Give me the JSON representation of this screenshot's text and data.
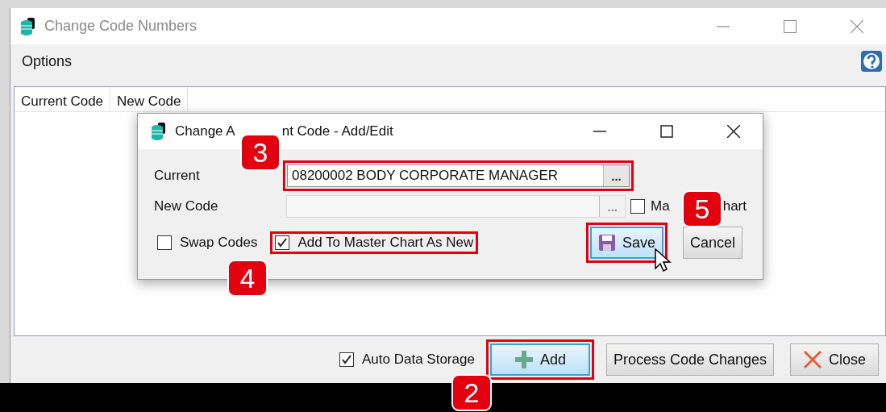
{
  "window": {
    "title": "Change Code Numbers"
  },
  "menu": [
    {
      "label": "Options"
    }
  ],
  "table": {
    "columns": [
      "Current Code",
      "New Code"
    ]
  },
  "footer": {
    "auto_data_storage": {
      "label": "Auto Data Storage",
      "checked": true
    },
    "buttons": [
      {
        "label": "Add",
        "kind": "add",
        "focused": true,
        "highlighted": true
      },
      {
        "label": "Process Code Changes",
        "kind": "plain",
        "focused": false,
        "highlighted": false
      },
      {
        "label": "Close",
        "kind": "close",
        "focused": false,
        "highlighted": false
      }
    ]
  },
  "dialog": {
    "title_parts": [
      "Change A",
      "nt Code - Add/Edit"
    ],
    "current": {
      "label": "Current",
      "value": "08200002 BODY CORPORATE MANAGER",
      "button": "...",
      "highlighted": true
    },
    "new_code": {
      "label": "New Code",
      "button": "...",
      "disabled": true
    },
    "master_chart": {
      "label_parts": [
        "Ma",
        "hart"
      ],
      "checked": false
    },
    "swap_codes": {
      "label": "Swap Codes",
      "checked": false,
      "highlighted": false
    },
    "add_to_master": {
      "label": "Add To Master Chart As New",
      "checked": true,
      "highlighted": true
    },
    "buttons": [
      {
        "label": "Save",
        "kind": "save",
        "focused": true,
        "highlighted": true
      },
      {
        "label": "Cancel",
        "kind": "plain",
        "focused": false,
        "highlighted": false
      }
    ]
  },
  "annotations": [
    {
      "label": "3"
    },
    {
      "label": "4"
    },
    {
      "label": "5"
    },
    {
      "label": "2"
    }
  ]
}
